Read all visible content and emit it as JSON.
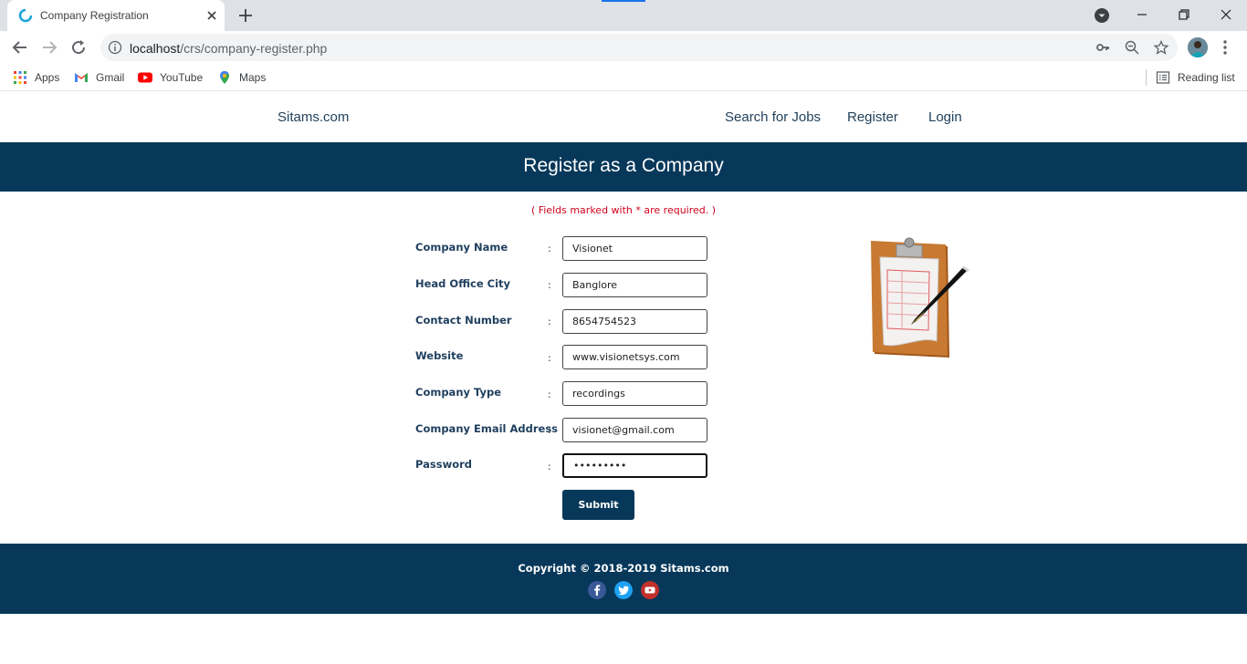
{
  "browser": {
    "tab_title": "Company Registration",
    "url_host": "localhost",
    "url_path": "/crs/company-register.php",
    "bookmarks": [
      {
        "label": "Apps",
        "icon": "apps-grid-icon"
      },
      {
        "label": "Gmail",
        "icon": "gmail-icon"
      },
      {
        "label": "YouTube",
        "icon": "youtube-icon"
      },
      {
        "label": "Maps",
        "icon": "maps-icon"
      }
    ],
    "reading_list": "Reading list"
  },
  "site": {
    "brand": "Sitams.com",
    "nav": [
      "Search for Jobs",
      "Register",
      "Login"
    ],
    "heading": "Register as a Company",
    "required_note": "( Fields marked with * are required. )"
  },
  "form": {
    "fields": [
      {
        "label": "Company Name",
        "value": "Visionet"
      },
      {
        "label": "Head Office City",
        "value": "Banglore"
      },
      {
        "label": "Contact Number",
        "value": "8654754523"
      },
      {
        "label": "Website",
        "value": "www.visionetsys.com"
      },
      {
        "label": "Company Type",
        "value": "recordings"
      },
      {
        "label": "Company Email Address",
        "value": "visionet@gmail.com"
      },
      {
        "label": "Password",
        "value": "•••••••••"
      }
    ],
    "colon": ":",
    "submit": "Submit"
  },
  "footer": {
    "copyright": "Copyright © 2018-2019 Sitams.com",
    "social": [
      "facebook-icon",
      "twitter-icon",
      "youtube-icon"
    ]
  },
  "colors": {
    "primary": "#07385a",
    "required": "#d0021b"
  }
}
